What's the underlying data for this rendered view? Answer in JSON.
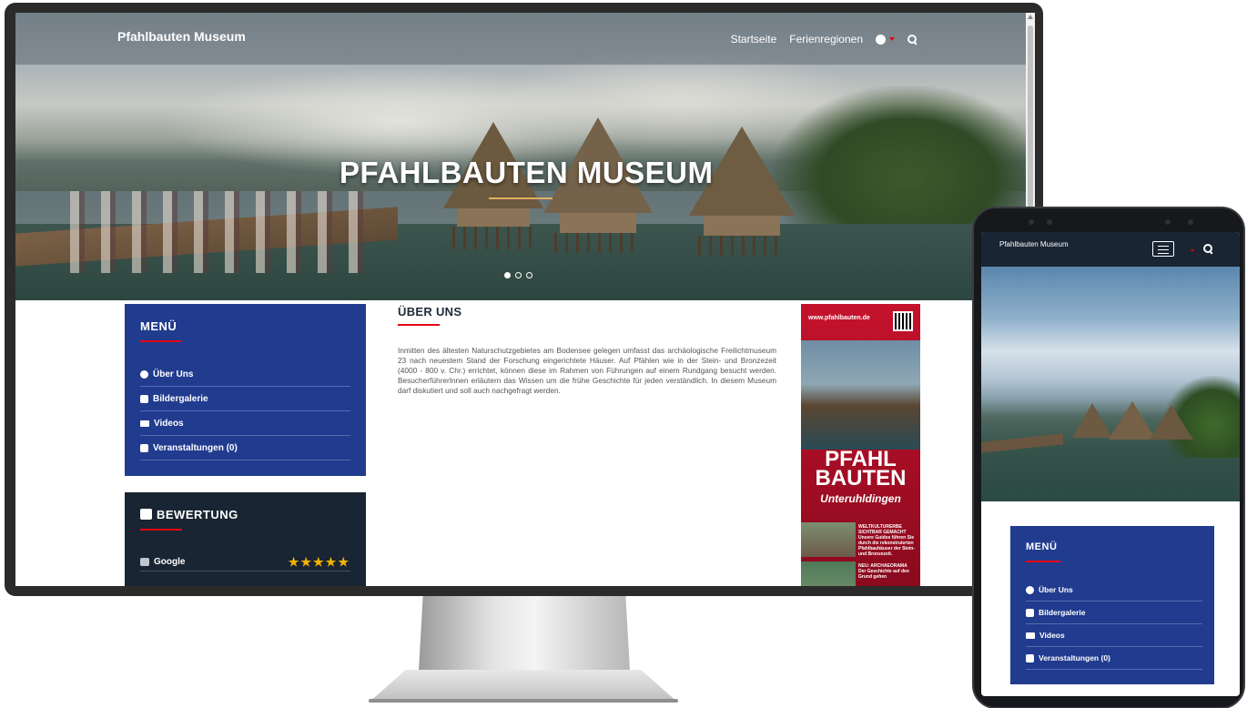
{
  "desktop": {
    "brand": "Pfahlbauten Museum",
    "nav": {
      "items": [
        "Startseite",
        "Ferienregionen"
      ],
      "icons": [
        "globe-icon",
        "caret-down-icon",
        "search-icon"
      ]
    },
    "hero": {
      "title": "PFAHLBAUTEN MUSEUM",
      "slides": 3,
      "active_slide": 1
    },
    "menu": {
      "title": "MENÜ",
      "items": [
        {
          "label": "Über Uns",
          "icon": "info-icon"
        },
        {
          "label": "Bildergalerie",
          "icon": "camera-icon"
        },
        {
          "label": "Videos",
          "icon": "video-icon"
        },
        {
          "label": "Veranstaltungen (0)",
          "icon": "calendar-icon"
        }
      ]
    },
    "rating": {
      "title": "BEWERTUNG",
      "icon": "google-plus-icon",
      "rows": [
        {
          "source": "Google",
          "stars": 5
        }
      ],
      "star_glyphs": "★★★★★"
    },
    "about": {
      "title": "ÜBER UNS",
      "text": "Inmitten des ältesten Naturschutzgebietes am Bodensee gelegen umfasst das archäologische Freilichtmuseum 23 nach neuestem Stand der Forschung eingerichtete Häuser. Auf Pfählen wie in der Stein- und Bronzezeit (4000 - 800 v. Chr.) errichtet, können diese im Rahmen von Führungen auf einem Rundgang besucht werden. BesucherführerInnen erläutern das Wissen um die frühe Geschichte für jeden verständlich. In diesem Museum darf diskutiert und soll auch nachgefragt werden."
    },
    "flyer": {
      "url": "www.pfahlbauten.de",
      "headline_1": "PFAHL",
      "headline_2": "BAUTEN",
      "subline": "Unteruhldingen",
      "block_1_title": "WELTKULTURERBE SICHTBAR GEMACHT",
      "block_1_text": "Unsere Guides führen Sie durch die rekonstruierten Pfahlbauhäuser der Stein- und Bronzezeit.",
      "block_2_title": "NEU: ARCHAEORAMA",
      "block_2_text": "Der Geschichte auf den Grund gehen"
    }
  },
  "mobile": {
    "brand": "Pfahlbauten Museum",
    "menu": {
      "title": "MENÜ",
      "items": [
        {
          "label": "Über Uns",
          "icon": "info-icon"
        },
        {
          "label": "Bildergalerie",
          "icon": "camera-icon"
        },
        {
          "label": "Videos",
          "icon": "video-icon"
        },
        {
          "label": "Veranstaltungen (0)",
          "icon": "calendar-icon"
        }
      ]
    }
  },
  "colors": {
    "menu_blue": "#213b8f",
    "dark_panel": "#192533",
    "accent_red": "#e30613",
    "star_gold": "#f4b400"
  }
}
